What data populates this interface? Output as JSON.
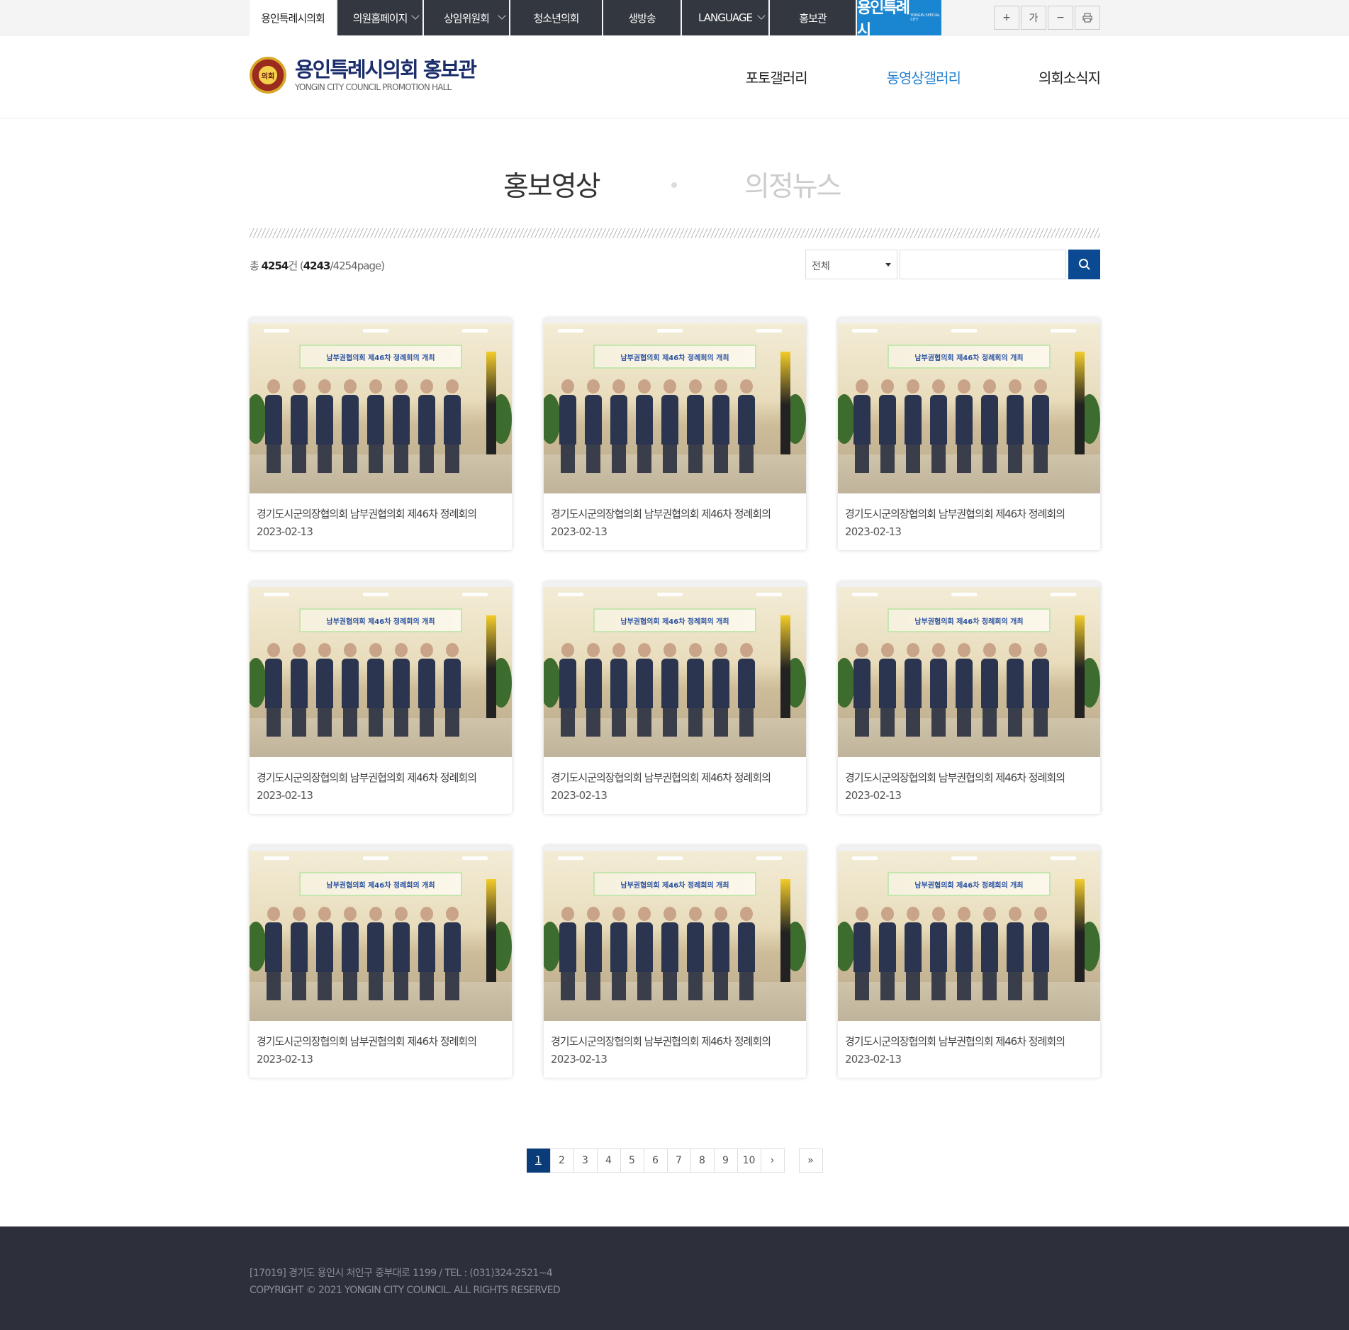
{
  "topbar": {
    "home": "용인특례시의회",
    "items": [
      "의원홈페이지",
      "상임위원회",
      "청소년의회",
      "생방송",
      "LANGUAGE",
      "홍보관"
    ],
    "yongin_logo": "용인특례시",
    "yongin_logo_sub": "YONGIN SPECIAL CITY",
    "tools": {
      "zoom_in": "+",
      "font": "가",
      "zoom_out": "−"
    }
  },
  "header": {
    "emblem": "의회",
    "title": "용인특례시의회 홍보관",
    "subtitle": "YONGIN CITY COUNCIL PROMOTION HALL",
    "nav": [
      "포토갤러리",
      "동영상갤러리",
      "의회소식지"
    ],
    "active_nav_index": 1
  },
  "tabs": {
    "active": "홍보영상",
    "inactive": "의정뉴스"
  },
  "listing": {
    "total_prefix": "총 ",
    "total": "4254",
    "total_suffix": "건 (",
    "current_page": "4243",
    "page_suffix": "/4254page)"
  },
  "search": {
    "select_value": "전체",
    "input_value": ""
  },
  "cards": [
    {
      "title": "경기도시군의장협의회 남부권협의회 제46차 정례회의",
      "date": "2023-02-13",
      "banner": "남부권협의회 제46차 정례회의 개최"
    },
    {
      "title": "경기도시군의장협의회 남부권협의회 제46차 정례회의",
      "date": "2023-02-13",
      "banner": "남부권협의회 제46차 정례회의 개최"
    },
    {
      "title": "경기도시군의장협의회 남부권협의회 제46차 정례회의",
      "date": "2023-02-13",
      "banner": "남부권협의회 제46차 정례회의 개최"
    },
    {
      "title": "경기도시군의장협의회 남부권협의회 제46차 정례회의",
      "date": "2023-02-13",
      "banner": "남부권협의회 제46차 정례회의 개최"
    },
    {
      "title": "경기도시군의장협의회 남부권협의회 제46차 정례회의",
      "date": "2023-02-13",
      "banner": "남부권협의회 제46차 정례회의 개최"
    },
    {
      "title": "경기도시군의장협의회 남부권협의회 제46차 정례회의",
      "date": "2023-02-13",
      "banner": "남부권협의회 제46차 정례회의 개최"
    },
    {
      "title": "경기도시군의장협의회 남부권협의회 제46차 정례회의",
      "date": "2023-02-13",
      "banner": "남부권협의회 제46차 정례회의 개최"
    },
    {
      "title": "경기도시군의장협의회 남부권협의회 제46차 정례회의",
      "date": "2023-02-13",
      "banner": "남부권협의회 제46차 정례회의 개최"
    },
    {
      "title": "경기도시군의장협의회 남부권협의회 제46차 정례회의",
      "date": "2023-02-13",
      "banner": "남부권협의회 제46차 정례회의 개최"
    }
  ],
  "pagination": {
    "pages": [
      "1",
      "2",
      "3",
      "4",
      "5",
      "6",
      "7",
      "8",
      "9",
      "10"
    ],
    "active": "1",
    "next": "›",
    "last": "»"
  },
  "footer": {
    "address": "[17019] 경기도 용인시 처인구 중부대로 1199 / TEL : (031)324-2521~4",
    "copyright": "COPYRIGHT © 2021 YONGIN CITY COUNCIL. ALL RIGHTS RESERVED"
  },
  "colors": {
    "accent": "#2480cf",
    "dark_blue": "#0b3c7a",
    "topbar_dark": "#33373f",
    "yongin_blue": "#1a85d0",
    "footer": "#2d2f3b"
  },
  "icons": {
    "search": "search-icon",
    "print": "print-icon",
    "plus": "zoom-in-icon",
    "minus": "zoom-out-icon"
  }
}
